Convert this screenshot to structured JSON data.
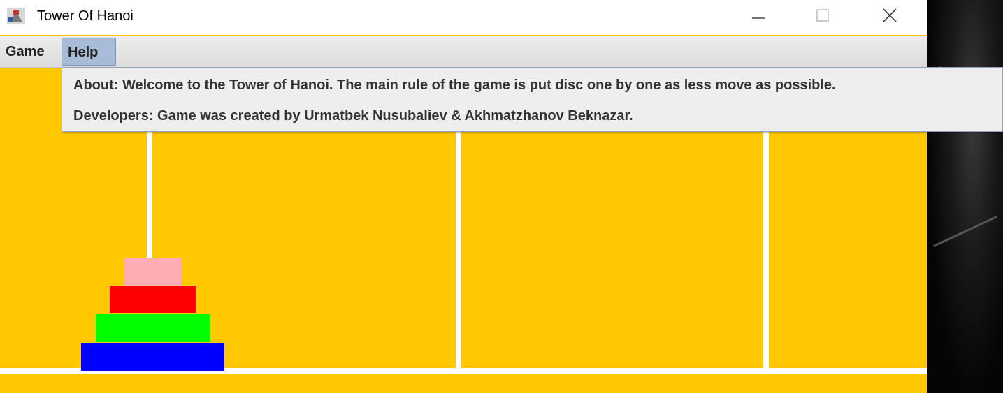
{
  "window": {
    "title": "Tower Of Hanoi"
  },
  "menubar": {
    "items": [
      {
        "label": "Game"
      },
      {
        "label": "Help"
      }
    ]
  },
  "help_menu": {
    "items": [
      {
        "label": "About: Welcome to the  Tower of Hanoi. The main rule of the game is put disc one by one as less move as possible."
      },
      {
        "label": "Developers: Game was created by Urmatbek Nusubaliev & Akhmatzhanov Beknazar."
      }
    ]
  },
  "game": {
    "background_color": "#ffc800",
    "rod_color": "#ffffff",
    "rods": 3,
    "discs": [
      {
        "color": "#ffadb5",
        "size": 1,
        "rod": 1
      },
      {
        "color": "#ff0000",
        "size": 2,
        "rod": 1
      },
      {
        "color": "#00ff00",
        "size": 3,
        "rod": 1
      },
      {
        "color": "#0000ff",
        "size": 4,
        "rod": 1
      }
    ]
  },
  "icons": {
    "app": "hanoi-app-icon",
    "minimize": "minimize-icon",
    "maximize": "maximize-icon",
    "close": "close-icon"
  }
}
